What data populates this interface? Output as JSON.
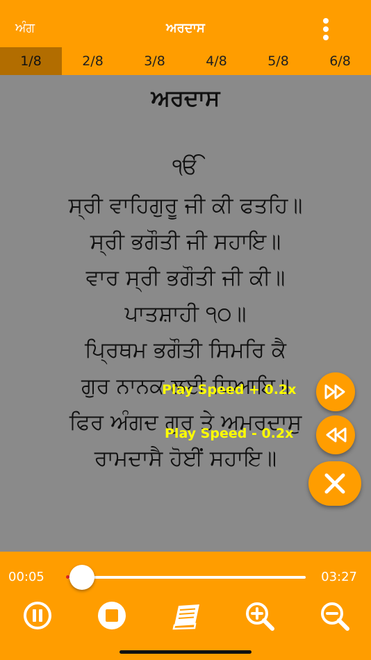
{
  "header": {
    "left_label": "ਅੰਗ",
    "title": "ਅਰਦਾਸ"
  },
  "tabs": [
    {
      "label": "1/8"
    },
    {
      "label": "2/8"
    },
    {
      "label": "3/8"
    },
    {
      "label": "4/8"
    },
    {
      "label": "5/8"
    },
    {
      "label": "6/8"
    }
  ],
  "content": {
    "heading": "ਅਰਦਾਸ",
    "lines": [
      "ੴ",
      "ਸ੍ਰੀ ਵਾਹਿਗੁਰੂ ਜੀ ਕੀ ਫਤਹਿ॥",
      "ਸ੍ਰੀ ਭਗੌਤੀ ਜੀ ਸਹਾਇ॥",
      "ਵਾਰ ਸ੍ਰੀ ਭਗੌਤੀ ਜੀ ਕੀ॥",
      "ਪਾਤਸ਼ਾਹੀ ੧੦॥",
      "ਪ੍ਰਿਥਮ ਭਗੌਤੀ ਸਿਮਰਿ ਕੈ",
      "ਗੁਰ ਨਾਨਕ ਲਈ ਧਿਆਇ॥",
      "ਫਿਰ ਅੰਗਦ ਗੁਰ ਤੇ ਅਮਰਦਾਸੁ",
      "ਰਾਮਦਾਸੈ ਹੋਈਂ ਸਹਾਇ॥"
    ]
  },
  "speed": {
    "up_label": "Play Speed + 0.2x",
    "down_label": "Play Speed - 0.2x"
  },
  "player": {
    "elapsed": "00:05",
    "total": "03:27",
    "progress": 0.024
  },
  "icons": {
    "menu": "more-vertical-icon",
    "fast_forward": "fast-forward-icon",
    "rewind": "rewind-icon",
    "close": "close-icon",
    "pause": "pause-icon",
    "stop": "stop-icon",
    "book": "book-icon",
    "zoom_in": "zoom-in-icon",
    "zoom_out": "zoom-out-icon"
  },
  "colors": {
    "accent": "#FF9D00",
    "active_tab": "#B26D00",
    "content_bg": "#8A8A8A",
    "speed_label": "#FFFF00"
  }
}
